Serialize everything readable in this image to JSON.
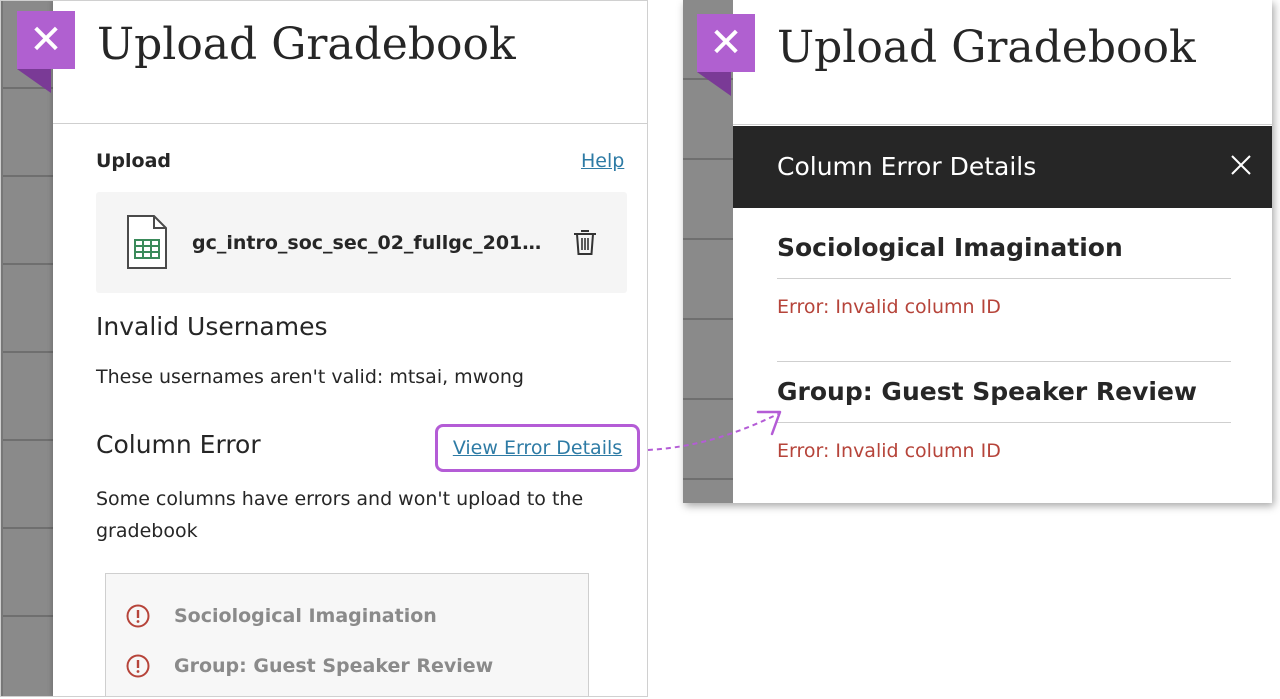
{
  "left": {
    "title": "Upload Gradebook",
    "upload_label": "Upload",
    "help_link": "Help",
    "file_name": "gc_intro_soc_sec_02_fullgc_2018-0...",
    "invalid_heading": "Invalid Usernames",
    "invalid_text": "These usernames aren't valid: mtsai, mwong",
    "column_error_heading": "Column Error",
    "view_error_details": "View Error Details",
    "column_error_text": "Some columns have errors and won't upload to the gradebook",
    "errors": [
      {
        "label": "Sociological Imagination"
      },
      {
        "label": "Group: Guest Speaker Review"
      }
    ]
  },
  "right": {
    "title": "Upload Gradebook",
    "panel_title": "Column Error Details",
    "items": [
      {
        "heading": "Sociological Imagination",
        "error": "Error: Invalid column ID"
      },
      {
        "heading": "Group: Guest Speaker Review",
        "error": "Error: Invalid column ID"
      }
    ]
  },
  "colors": {
    "accent": "#b060d0",
    "link": "#2e7ba5",
    "error": "#b6443a",
    "dark_bar": "#262626"
  },
  "icons": [
    "close-icon",
    "spreadsheet-file-icon",
    "trash-icon",
    "alert-icon",
    "annotation-arrow"
  ]
}
